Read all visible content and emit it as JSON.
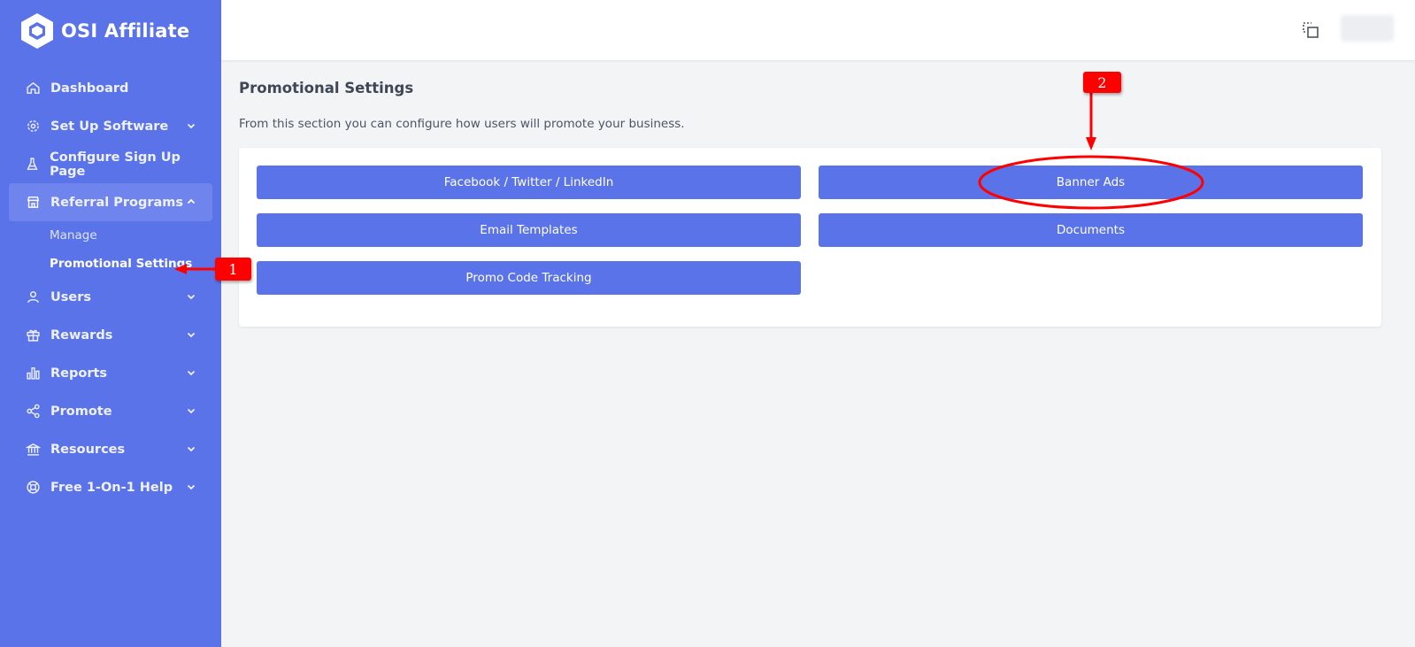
{
  "app": {
    "brand": "OSI Affiliate"
  },
  "sidebar": {
    "items": [
      {
        "label": "Dashboard",
        "icon": "home-icon"
      },
      {
        "label": "Set Up Software",
        "icon": "gear-icon"
      },
      {
        "label": "Configure Sign Up Page",
        "icon": "flask-icon"
      },
      {
        "label": "Referral Programs",
        "icon": "store-icon"
      },
      {
        "label": "Users",
        "icon": "user-icon"
      },
      {
        "label": "Rewards",
        "icon": "gift-icon"
      },
      {
        "label": "Reports",
        "icon": "bar-chart-icon"
      },
      {
        "label": "Promote",
        "icon": "share-icon"
      },
      {
        "label": "Resources",
        "icon": "bank-icon"
      },
      {
        "label": "Free 1-On-1 Help",
        "icon": "lifebuoy-icon"
      }
    ],
    "referral_sub": [
      {
        "label": "Manage"
      },
      {
        "label": "Promotional Settings"
      }
    ]
  },
  "main": {
    "title": "Promotional Settings",
    "description": "From this section you can configure how users will promote your business.",
    "buttons": [
      {
        "label": "Facebook / Twitter / LinkedIn"
      },
      {
        "label": "Banner Ads"
      },
      {
        "label": "Email Templates"
      },
      {
        "label": "Documents"
      },
      {
        "label": "Promo Code Tracking"
      }
    ]
  },
  "annotations": {
    "step1": "1",
    "step2": "2"
  },
  "colors": {
    "accent": "#5b73e8",
    "annotation": "#ff0000",
    "background": "#f3f4f6"
  }
}
